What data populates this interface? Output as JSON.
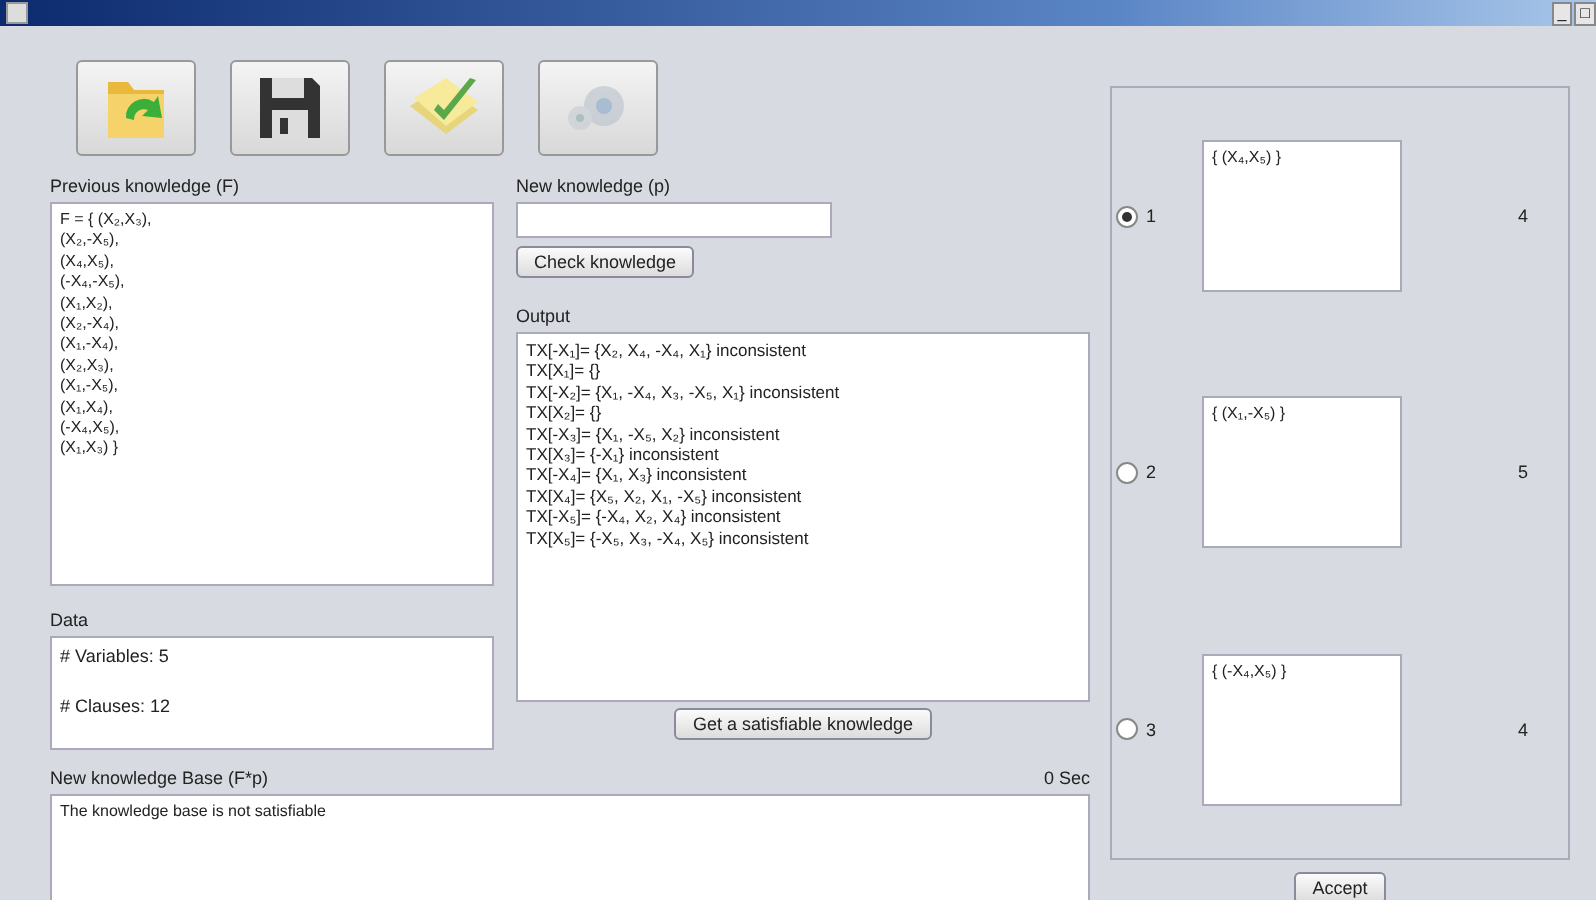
{
  "window": {
    "controls": [
      "_",
      "□"
    ]
  },
  "toolbar": [
    {
      "kind": "open"
    },
    {
      "kind": "save"
    },
    {
      "kind": "check"
    },
    {
      "kind": "settings",
      "disabled": true
    }
  ],
  "previous_knowledge": {
    "label": "Previous knowledge (F)",
    "lines": [
      "F = { (X₂,X₃),",
      "(X₂,-X₅),",
      "(X₄,X₅),",
      "(-X₄,-X₅),",
      "(X₁,X₂),",
      "(X₂,-X₄),",
      "(X₁,-X₄),",
      "(X₂,X₃),",
      "(X₁,-X₅),",
      "(X₁,X₄),",
      "(-X₄,X₅),",
      "(X₁,X₃) }"
    ]
  },
  "data": {
    "label": "Data",
    "lines": [
      "# Variables: 5",
      "# Clauses: 12"
    ]
  },
  "new_knowledge": {
    "label": "New knowledge (p)",
    "button": "Check knowledge"
  },
  "output": {
    "label": "Output",
    "lines": [
      "TX[-X₁]= {X₂, X₄, -X₄, X₁} inconsistent",
      "TX[X₁]= {}",
      "TX[-X₂]= {X₁, -X₄, X₃, -X₅, X₁} inconsistent",
      "TX[X₂]= {}",
      "TX[-X₃]= {X₁, -X₅, X₂} inconsistent",
      "TX[X₃]= {-X₁} inconsistent",
      "TX[-X₄]= {X₁, X₃} inconsistent",
      "TX[X₄]= {X₅, X₂, X₁, -X₅} inconsistent",
      "TX[-X₅]= {-X₄, X₂, X₄} inconsistent",
      "TX[X₅]= {-X₅, X₃, -X₄, X₅} inconsistent"
    ],
    "button": "Get a satisfiable knowledge"
  },
  "new_knowledge_base": {
    "label": "New knowledge Base (F*p)",
    "time": "0 Sec",
    "text": "The knowledge base is not satisfiable"
  },
  "options": [
    {
      "label": "1",
      "selected": true,
      "text": "{ (X₄,X₅) }",
      "count": "4"
    },
    {
      "label": "2",
      "selected": false,
      "text": "{ (X₁,-X₅) }",
      "count": "5"
    },
    {
      "label": "3",
      "selected": false,
      "text": "{ (-X₄,X₅) }",
      "count": "4"
    }
  ],
  "accept_button": "Accept"
}
